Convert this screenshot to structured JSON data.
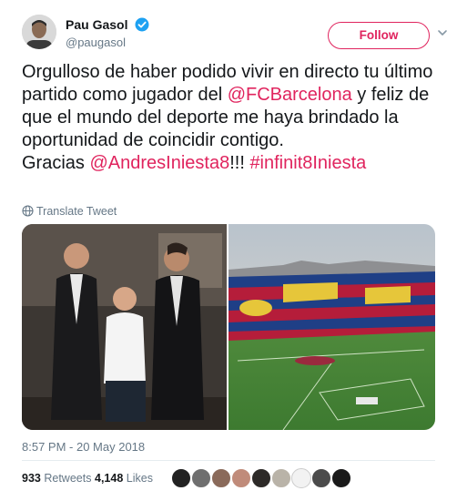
{
  "author": {
    "display_name": "Pau Gasol",
    "handle": "@paugasol",
    "verified": true
  },
  "follow_button": {
    "label": "Follow"
  },
  "tweet": {
    "text_1": "Orgulloso de haber podido vivir en directo tu último partido como jugador del ",
    "mention_1": "@FCBarcelona",
    "text_2": " y feliz de que el mundo del deporte me haya brindado la oportunidad de coincidir contigo.\nGracias ",
    "mention_2": "@AndresIniesta8",
    "text_3": "!!! ",
    "hashtag": "#infinit8Iniesta"
  },
  "translate": {
    "label": "Translate Tweet"
  },
  "timestamp": "8:57 PM - 20 May 2018",
  "stats": {
    "retweets_count": "933",
    "retweets_label": "Retweets",
    "likes_count": "4,148",
    "likes_label": "Likes"
  },
  "colors": {
    "accent": "#e0245e",
    "verified": "#1da1f2",
    "secondary_text": "#657786",
    "primary_text": "#14171a"
  },
  "icons": {
    "verified": "verified-badge-icon",
    "caret": "chevron-down-icon",
    "translate": "globe-icon"
  },
  "media": [
    {
      "description": "photo-three-men-suits"
    },
    {
      "description": "photo-stadium-mosaic"
    }
  ],
  "liker_avatars": 9
}
